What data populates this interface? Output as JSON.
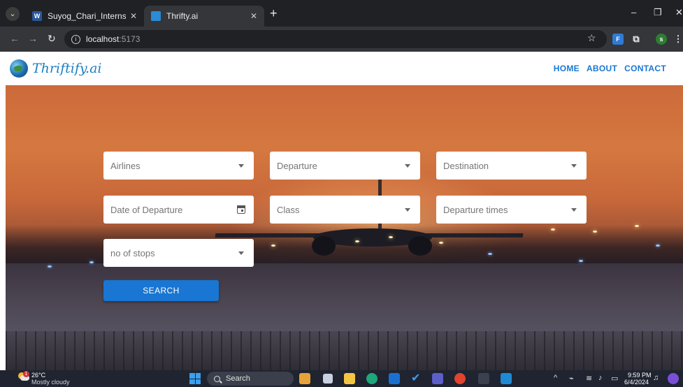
{
  "browser": {
    "tabs": [
      {
        "title": "Suyog_Chari_InternshipReport.d",
        "favicon_letter": "W",
        "active": false
      },
      {
        "title": "Thrifty.ai",
        "active": true
      }
    ],
    "url_host": "localhost",
    "url_port": ":5173",
    "profile_initial": "s"
  },
  "site": {
    "brand": "Thriftify.ai",
    "nav": [
      "HOME",
      "ABOUT",
      "CONTACT"
    ]
  },
  "form": {
    "airlines": "Airlines",
    "departure": "Departure",
    "destination": "Destination",
    "date_of_departure": "Date of Departure",
    "class": "Class",
    "departure_times": "Departure times",
    "stops": "no of stops",
    "search_label": "SEARCH"
  },
  "taskbar": {
    "temperature": "26°C",
    "weather": "Mostly cloudy",
    "weather_badge": "1",
    "search_label": "Search",
    "time": "9:59 PM",
    "date": "6/4/2024"
  },
  "colors": {
    "primary": "#1976d2",
    "browser_dark": "#202124"
  }
}
